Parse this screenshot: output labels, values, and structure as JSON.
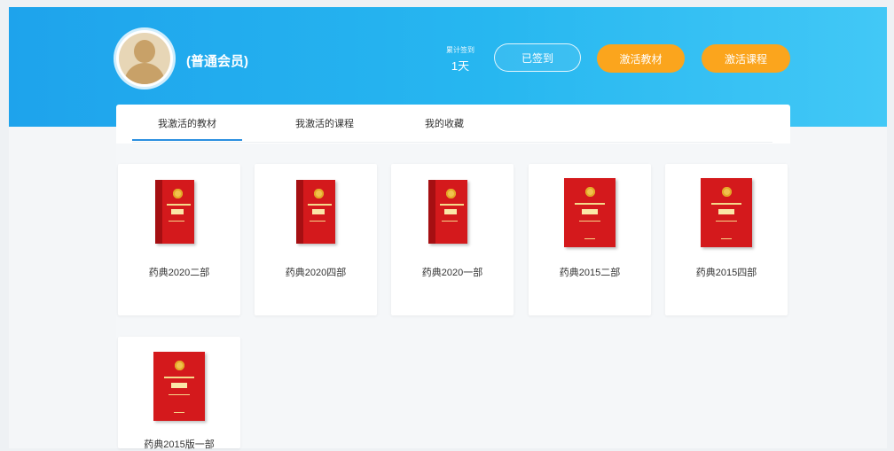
{
  "header": {
    "member_label": "(普通会员)",
    "checkin_caption": "累计签到",
    "checkin_days": "1天",
    "signed_label": "已签到",
    "activate_textbook_label": "激活教材",
    "activate_course_label": "激活课程"
  },
  "tabs": [
    {
      "label": "我激活的教材",
      "active": true
    },
    {
      "label": "我激活的课程",
      "active": false
    },
    {
      "label": "我的收藏",
      "active": false
    }
  ],
  "books": [
    {
      "title": "药典2020二部",
      "cover": "book-3d"
    },
    {
      "title": "药典2020四部",
      "cover": "book-3d"
    },
    {
      "title": "药典2020一部",
      "cover": "book-3d"
    },
    {
      "title": "药典2015二部",
      "cover": "book-flat"
    },
    {
      "title": "药典2015四部",
      "cover": "book-flat"
    },
    {
      "title": "药典2015版一部",
      "cover": "book-flat"
    }
  ],
  "colors": {
    "header_gradient_start": "#1ea3ec",
    "header_gradient_end": "#42c8f6",
    "accent_orange": "#fba51d",
    "tab_active_underline": "#2b8fe0",
    "book_red": "#d4191c"
  },
  "icons": {
    "avatar": "user-avatar-icon",
    "cover_emblem": "national-emblem-icon"
  }
}
